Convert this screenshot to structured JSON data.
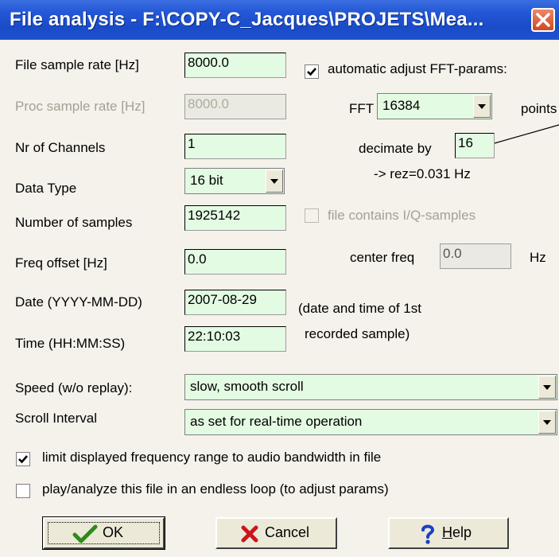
{
  "window": {
    "title": "File analysis - F:\\COPY-C_Jacques\\PROJETS\\Mea..."
  },
  "left": {
    "file_sample_rate_label": "File sample rate [Hz]",
    "file_sample_rate_value": "8000.0",
    "proc_sample_rate_label": "Proc sample rate [Hz]",
    "proc_sample_rate_value": "8000.0",
    "channels_label": "Nr of Channels",
    "channels_value": "1",
    "data_type_label": "Data Type",
    "data_type_value": "16 bit",
    "num_samples_label": "Number of samples",
    "num_samples_value": "1925142",
    "freq_offset_label": "Freq offset [Hz]",
    "freq_offset_value": "0.0",
    "date_label": "Date (YYYY-MM-DD)",
    "date_value": "2007-08-29",
    "time_label": "Time (HH:MM:SS)",
    "time_value": "22:10:03"
  },
  "right": {
    "auto_fft_label": "automatic adjust FFT-params:",
    "auto_fft_checked": true,
    "fft_label": "FFT",
    "fft_value": "16384",
    "points_label": "points",
    "decimate_label": "decimate by",
    "decimate_value": "16",
    "rez_text": "-> rez=0.031 Hz",
    "iq_label": "file contains I/Q-samples",
    "iq_checked": false,
    "center_freq_label": "center freq",
    "center_freq_value": "0.0",
    "hz_label": "Hz",
    "date_note_line1": "(date and time of 1st",
    "date_note_line2": "recorded sample)"
  },
  "speed": {
    "label": "Speed (w/o replay):",
    "value": "slow, smooth scroll"
  },
  "scroll": {
    "label": "Scroll Interval",
    "value": "as set for real-time operation"
  },
  "options": {
    "limit_label": "limit displayed frequency range to audio bandwidth in file",
    "limit_checked": true,
    "loop_label": "play/analyze this file in an endless loop (to adjust params)",
    "loop_checked": false
  },
  "buttons": {
    "ok": "OK",
    "cancel": "Cancel",
    "help_h": "H",
    "help_rest": "elp"
  },
  "colors": {
    "field_bg": "#e3fbe3",
    "title_blue": "#2457d6",
    "dialog_bg": "#f4f2ea"
  }
}
